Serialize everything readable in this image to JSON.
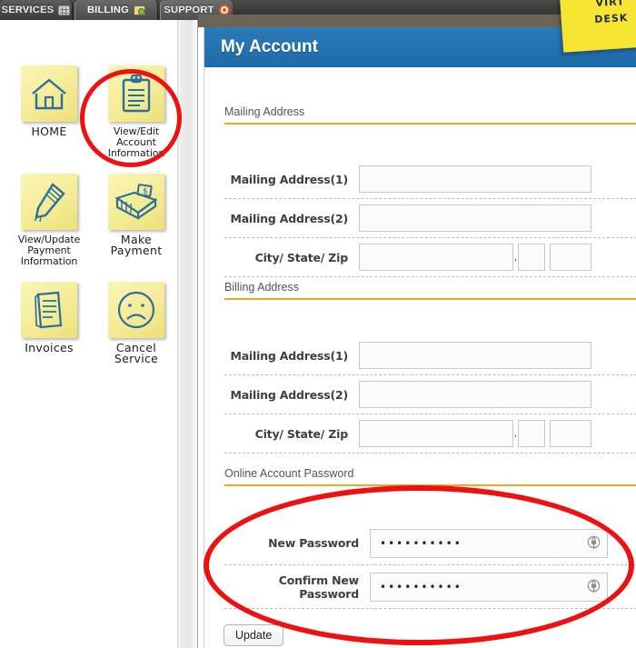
{
  "tabs": [
    {
      "label": "SERVICES",
      "icon": "grid-icon",
      "active": false
    },
    {
      "label": "BILLING",
      "icon": "money-icon",
      "active": true
    },
    {
      "label": "SUPPORT",
      "icon": "lifering-icon",
      "active": false
    }
  ],
  "sidebar": {
    "items": [
      {
        "label": "HOME",
        "icon": "house-icon"
      },
      {
        "label": "View/Edit\nAccount\nInformation",
        "icon": "clipboard-icon"
      },
      {
        "label": "View/Update\nPayment\nInformation",
        "icon": "pencil-icon"
      },
      {
        "label": "Make Payment",
        "icon": "wallet-money-icon"
      },
      {
        "label": "Invoices",
        "icon": "document-icon"
      },
      {
        "label": "Cancel Service",
        "icon": "sad-face-icon"
      }
    ]
  },
  "panel": {
    "title": "My Account",
    "header_color": "#1f6aa8",
    "accent_color": "#f0a81e",
    "sections": [
      {
        "heading": "Mailing Address",
        "rows": [
          {
            "label": "Mailing Address(1)",
            "type": "text",
            "value": ""
          },
          {
            "label": "Mailing Address(2)",
            "type": "text",
            "value": ""
          },
          {
            "label": "City/ State/ Zip",
            "type": "city_state_zip",
            "city": "",
            "separator": ",",
            "state": "",
            "zip": ""
          }
        ]
      },
      {
        "heading": "Billing Address",
        "rows": [
          {
            "label": "Mailing Address(1)",
            "type": "text",
            "value": ""
          },
          {
            "label": "Mailing Address(2)",
            "type": "text",
            "value": ""
          },
          {
            "label": "City/ State/ Zip",
            "type": "city_state_zip",
            "city": "",
            "separator": ",",
            "state": "",
            "zip": ""
          }
        ]
      },
      {
        "heading": "Online Account Password",
        "rows": [
          {
            "label": "New Password",
            "type": "password",
            "value": "••••••••••",
            "icon": "key-lock-icon"
          },
          {
            "label": "Confirm New Password",
            "type": "password",
            "value": "••••••••••",
            "icon": "key-lock-icon"
          }
        ]
      }
    ],
    "update_label": "Update"
  },
  "sticky_note": {
    "line1": "VIRT",
    "line2": "DESK",
    "color": "#f7e532"
  },
  "annotations": {
    "color": "#ee1111",
    "shapes": [
      {
        "name": "sidebar-highlight",
        "target": "View/Edit Account Information"
      },
      {
        "name": "password-section-highlight",
        "target": "Online Account Password"
      }
    ]
  }
}
